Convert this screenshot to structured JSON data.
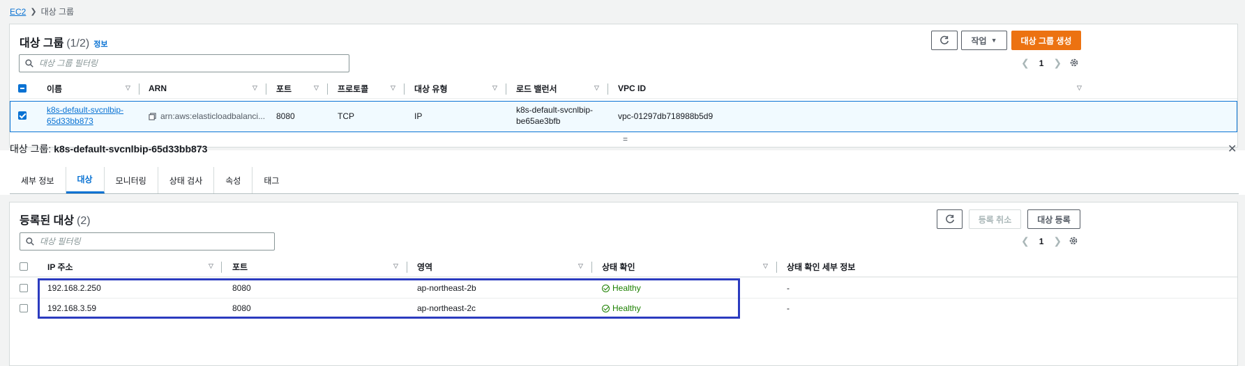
{
  "breadcrumb": {
    "root": "EC2",
    "current": "대상 그룹"
  },
  "target_groups": {
    "title": "대상 그룹",
    "count": "(1/2)",
    "info": "정보",
    "refresh_icon": "refresh-icon",
    "actions_label": "작업",
    "create_label": "대상 그룹 생성",
    "search_placeholder": "대상 그룹 필터링",
    "page": "1",
    "columns": [
      "이름",
      "ARN",
      "포트",
      "프로토콜",
      "대상 유형",
      "로드 밸런서",
      "VPC ID"
    ],
    "rows": [
      {
        "name_line1": "k8s-default-svcnlbip-",
        "name_line2": "65d33bb873",
        "arn": "arn:aws:elasticloadbalanci...",
        "port": "8080",
        "protocol": "TCP",
        "target_type": "IP",
        "lb_line1": "k8s-default-svcnlbip-",
        "lb_line2": "be65ae3bfb",
        "vpc": "vpc-01297db718988b5d9"
      }
    ]
  },
  "splitter": "=",
  "detail": {
    "title_prefix": "대상 그룹:",
    "title_name": "k8s-default-svcnlbip-65d33bb873",
    "tabs": [
      "세부 정보",
      "대상",
      "모니터링",
      "상태 검사",
      "속성",
      "태그"
    ],
    "active_tab": 1
  },
  "registered": {
    "title": "등록된 대상",
    "count": "(2)",
    "deregister_label": "등록 취소",
    "register_label": "대상 등록",
    "search_placeholder": "대상 필터링",
    "page": "1",
    "columns": [
      "IP 주소",
      "포트",
      "영역",
      "상태 확인",
      "상태 확인 세부 정보"
    ],
    "rows": [
      {
        "ip": "192.168.2.250",
        "port": "8080",
        "zone": "ap-northeast-2b",
        "health": "Healthy",
        "details": "-"
      },
      {
        "ip": "192.168.3.59",
        "port": "8080",
        "zone": "ap-northeast-2c",
        "health": "Healthy",
        "details": "-"
      }
    ]
  },
  "colors": {
    "accent": "#0972d3",
    "primary_button": "#ec7211",
    "healthy": "#1d8102",
    "highlight_box": "#2b3bbf"
  }
}
